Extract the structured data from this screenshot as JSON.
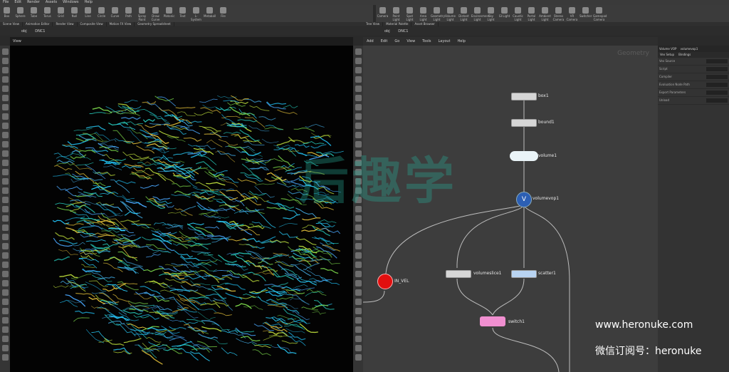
{
  "menubar": [
    "File",
    "Edit",
    "Render",
    "Assets",
    "Windows",
    "Help"
  ],
  "left_shelf_tools": [
    "Box",
    "Sphere",
    "Tube",
    "Torus",
    "Grid",
    "Null",
    "Line",
    "Circle",
    "Curve",
    "Path",
    "Spray Paint",
    "Draw Curve",
    "Platonic",
    "Text",
    "L-System",
    "Metaball",
    "File"
  ],
  "right_shelf_tools": [
    "Camera",
    "Point Light",
    "Spot Light",
    "Area Light",
    "Geometry Light",
    "Volume Light",
    "Distant Light",
    "Environment Light",
    "Sky Light",
    "GI Light",
    "Caustic Light",
    "Portal Light",
    "Ambient Light",
    "Stereo Camera",
    "VR Camera",
    "Switcher",
    "Gamepad Camera"
  ],
  "left_panel_tabs": [
    "Scene View",
    "Animation Editor",
    "Render View",
    "Composite View",
    "Motion FX View",
    "Geometry Spreadsheet"
  ],
  "viewport_title": "View",
  "viewport_path": "obj",
  "viewport_node": "DNC1",
  "network_tabs": [
    "Tree View",
    "Material Palette",
    "Asset Browser"
  ],
  "network_path": "obj",
  "network_node": "DNC1",
  "network_menu": [
    "Add",
    "Edit",
    "Go",
    "View",
    "Tools",
    "Layout",
    "Help"
  ],
  "network_context": "Geometry",
  "nodes": {
    "box1": "box1",
    "bound1": "bound1",
    "volume1": "volume1",
    "volumevop1": "volumevop1",
    "in_vel": "IN_VEL",
    "volumeslice1": "volumeslice1",
    "scatter1": "scatter1",
    "switch1": "switch1"
  },
  "parm": {
    "header_type": "Volume VOP",
    "header_name": "volumevop1",
    "tabs": [
      "Vex Setup",
      "Bindings"
    ],
    "rows": [
      "Vex Source",
      "Script",
      "Compiler",
      "Evaluation Node Path",
      "Export Parameters",
      "Unload"
    ]
  },
  "watermark": {
    "site": "www.heronuke.com",
    "wechat": "微信订阅号：heronuke",
    "logo_text": "后趣学"
  }
}
